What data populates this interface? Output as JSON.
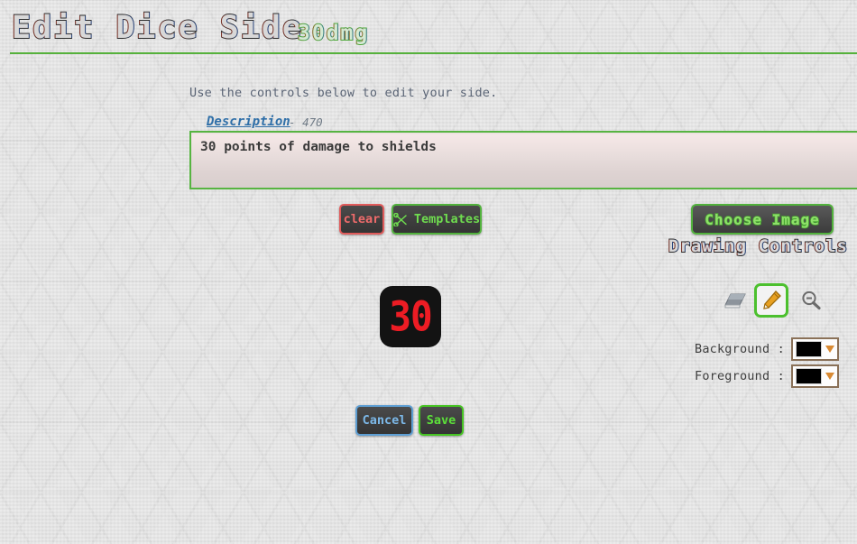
{
  "header": {
    "title": "Edit Dice Side",
    "subtitle": "30dmg",
    "rule_color": "#56b13c"
  },
  "instructions": "Use the controls below to edit your side.",
  "description": {
    "label": "Description",
    "separator": "-",
    "remaining": "470",
    "value": "30 points of damage to shields",
    "placeholder": "",
    "border_color": "#57b441"
  },
  "actions": {
    "clear_label": "clear",
    "clear_color": "#ef6b6b",
    "templates_label": "Templates",
    "templates_color": "#6fdd4f",
    "templates_icon": "scissors-icon",
    "choose_image_label": "Choose Image",
    "choose_image_color": "#8fe06a"
  },
  "drawing": {
    "heading": "Drawing Controls",
    "tools": [
      {
        "name": "eraser-tool",
        "icon": "eraser-icon",
        "selected": false
      },
      {
        "name": "pencil-tool",
        "icon": "pencil-icon",
        "selected": true
      },
      {
        "name": "zoom-out-tool",
        "icon": "magnifier-minus-icon",
        "selected": false
      }
    ],
    "background": {
      "label": "Background :",
      "color": "#000000"
    },
    "foreground": {
      "label": "Foreground :",
      "color": "#000000"
    }
  },
  "dice_preview": {
    "value": "30",
    "text_color": "#ed1c24",
    "background_color": "#131313"
  },
  "footer": {
    "cancel_label": "Cancel",
    "cancel_color": "#7cb8e8",
    "save_label": "Save",
    "save_color": "#5ce03a"
  }
}
